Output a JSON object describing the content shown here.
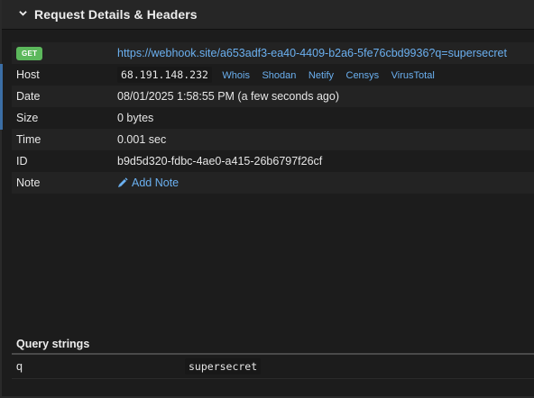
{
  "panel": {
    "title": "Request Details & Headers",
    "chevron_icon": "chevron-down-icon"
  },
  "details": {
    "method": "GET",
    "url": "https://webhook.site/a653adf3-ea40-4409-b2a6-5fe76cbd9936?q=supersecret",
    "host": {
      "label": "Host",
      "ip": "68.191.148.232",
      "links": [
        "Whois",
        "Shodan",
        "Netify",
        "Censys",
        "VirusTotal"
      ]
    },
    "date": {
      "label": "Date",
      "value": "08/01/2025 1:58:55 PM (a few seconds ago)"
    },
    "size": {
      "label": "Size",
      "value": "0 bytes"
    },
    "time": {
      "label": "Time",
      "value": "0.001 sec"
    },
    "id": {
      "label": "ID",
      "value": "b9d5d320-fdbc-4ae0-a415-26b6797f26cf"
    },
    "note": {
      "label": "Note",
      "action": "Add Note",
      "icon": "pencil-icon"
    }
  },
  "query_strings": {
    "title": "Query strings",
    "rows": [
      {
        "key": "q",
        "value": "supersecret"
      }
    ]
  },
  "colors": {
    "background": "#1c1c1c",
    "header": "#262626",
    "link": "#6bb0f0",
    "get_badge": "#5cb85c",
    "accent": "#3b6ea5"
  }
}
